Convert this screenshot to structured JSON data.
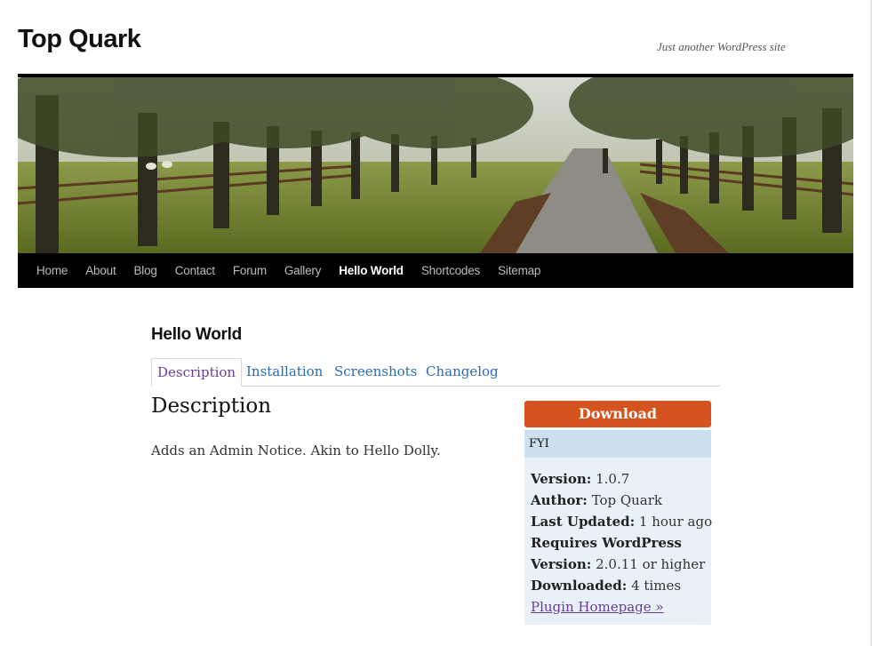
{
  "site": {
    "title": "Top Quark",
    "tagline": "Just another WordPress site"
  },
  "nav": {
    "items": [
      "Home",
      "About",
      "Blog",
      "Contact",
      "Forum",
      "Gallery",
      "Hello World",
      "Shortcodes",
      "Sitemap"
    ],
    "current": "Hello World"
  },
  "page": {
    "title": "Hello World",
    "tabs": [
      "Description",
      "Installation",
      "Screenshots",
      "Changelog"
    ],
    "active_tab": "Description",
    "section_heading": "Description",
    "description": "Adds an Admin Notice. Akin to Hello Dolly."
  },
  "sidebar": {
    "download_label": "Download",
    "fyi_heading": "FYI",
    "version_label": "Version:",
    "version_value": "1.0.7",
    "author_label": "Author:",
    "author_value": "Top Quark",
    "updated_label": "Last Updated:",
    "updated_value": "1 hour ago",
    "requires_label_1": "Requires WordPress",
    "requires_label_2": "Version:",
    "requires_value": "2.0.11 or higher",
    "downloaded_label": "Downloaded:",
    "downloaded_value": "4 times",
    "homepage_link": "Plugin Homepage »"
  },
  "colors": {
    "download_button": "#d4531f",
    "fyi_header": "#cde0ef",
    "fyi_body": "#e8f0f8",
    "link": "#2a6bb5",
    "visited_link": "#6a3c98"
  }
}
